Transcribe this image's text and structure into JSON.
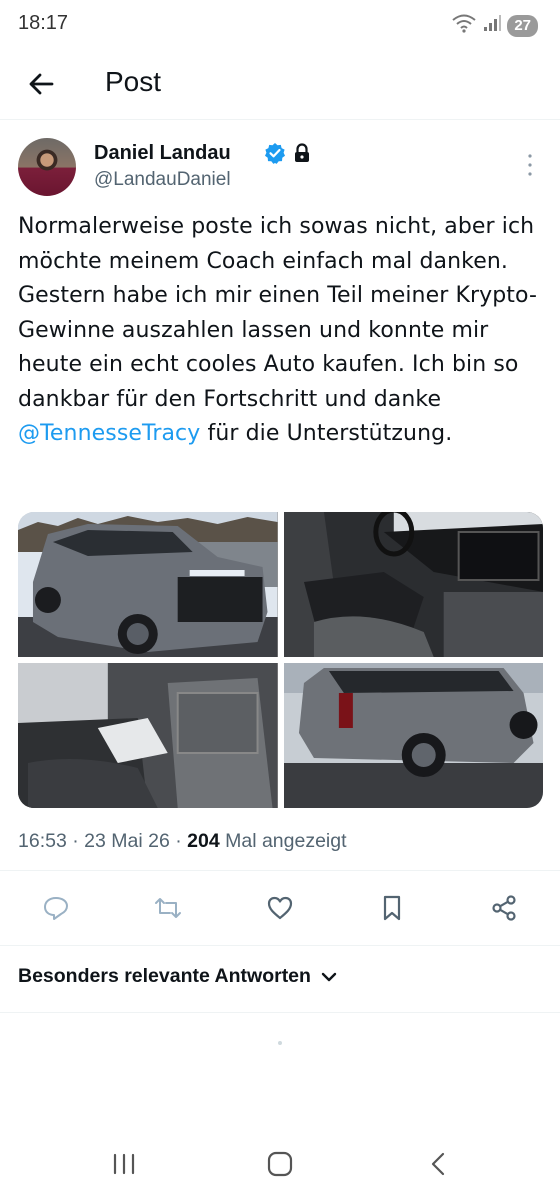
{
  "status_bar": {
    "time": "18:17",
    "battery": "27"
  },
  "header": {
    "title": "Post"
  },
  "post": {
    "author": {
      "display_name": "Daniel Landau",
      "handle": "@LandauDaniel"
    },
    "text_before": "Normalerweise poste ich sowas nicht, aber ich möchte meinem Coach einfach mal danken. Gestern habe ich mir einen Teil meiner Krypto-Gewinne auszahlen lassen und konnte mir heute ein echt cooles Auto kaufen. Ich bin so dankbar für den Fortschritt und danke ",
    "mention": "@TennesseTracy",
    "text_after": " für die Unterstützung.",
    "meta": {
      "time": "16:53",
      "sep1": " · ",
      "date": "23 Mai 26",
      "sep2": " · ",
      "views": "204",
      "views_label": " Mal angezeigt"
    }
  },
  "replies_sort": {
    "label": "Besonders relevante Antworten"
  },
  "colors": {
    "accent": "#1d9bf0",
    "text": "#0f1419",
    "muted": "#536471",
    "border": "#eff3f4"
  }
}
